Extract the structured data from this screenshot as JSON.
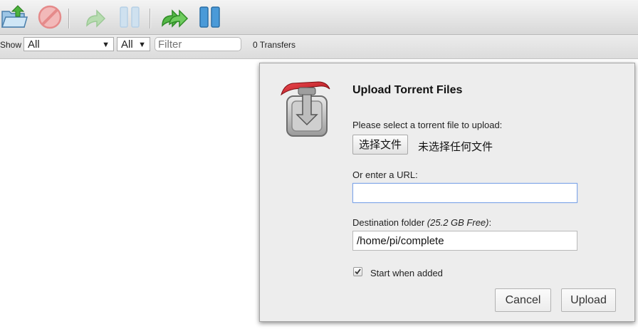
{
  "toolbar": {
    "buttons": [
      {
        "name": "open",
        "icon": "open-folder-icon"
      },
      {
        "name": "remove",
        "icon": "remove-icon"
      },
      {
        "name": "resume",
        "icon": "resume-icon"
      },
      {
        "name": "pause",
        "icon": "pause-icon"
      },
      {
        "name": "resume-all",
        "icon": "resume-all-icon"
      },
      {
        "name": "pause-all",
        "icon": "pause-all-icon"
      }
    ]
  },
  "filterbar": {
    "show_label": "Show",
    "status_select": "All",
    "tracker_select": "All",
    "filter_placeholder": "Filter",
    "transfers": "0 Transfers"
  },
  "dialog": {
    "title": "Upload Torrent Files",
    "select_label": "Please select a torrent file to upload:",
    "choose_file_button": "选择文件",
    "no_file_chosen": "未选择任何文件",
    "url_label": "Or enter a URL:",
    "url_value": "",
    "destination_label": "Destination folder",
    "free_space": "(25.2 GB Free)",
    "destination_suffix": ":",
    "destination_value": "/home/pi/complete",
    "start_when_added_label": "Start when added",
    "start_when_added_checked": true,
    "cancel_button": "Cancel",
    "upload_button": "Upload"
  },
  "colors": {
    "accent_green": "#3fa535",
    "remove_red": "#e25a5a",
    "pause_blue": "#3b8fd0",
    "logo_red": "#c7202a"
  }
}
